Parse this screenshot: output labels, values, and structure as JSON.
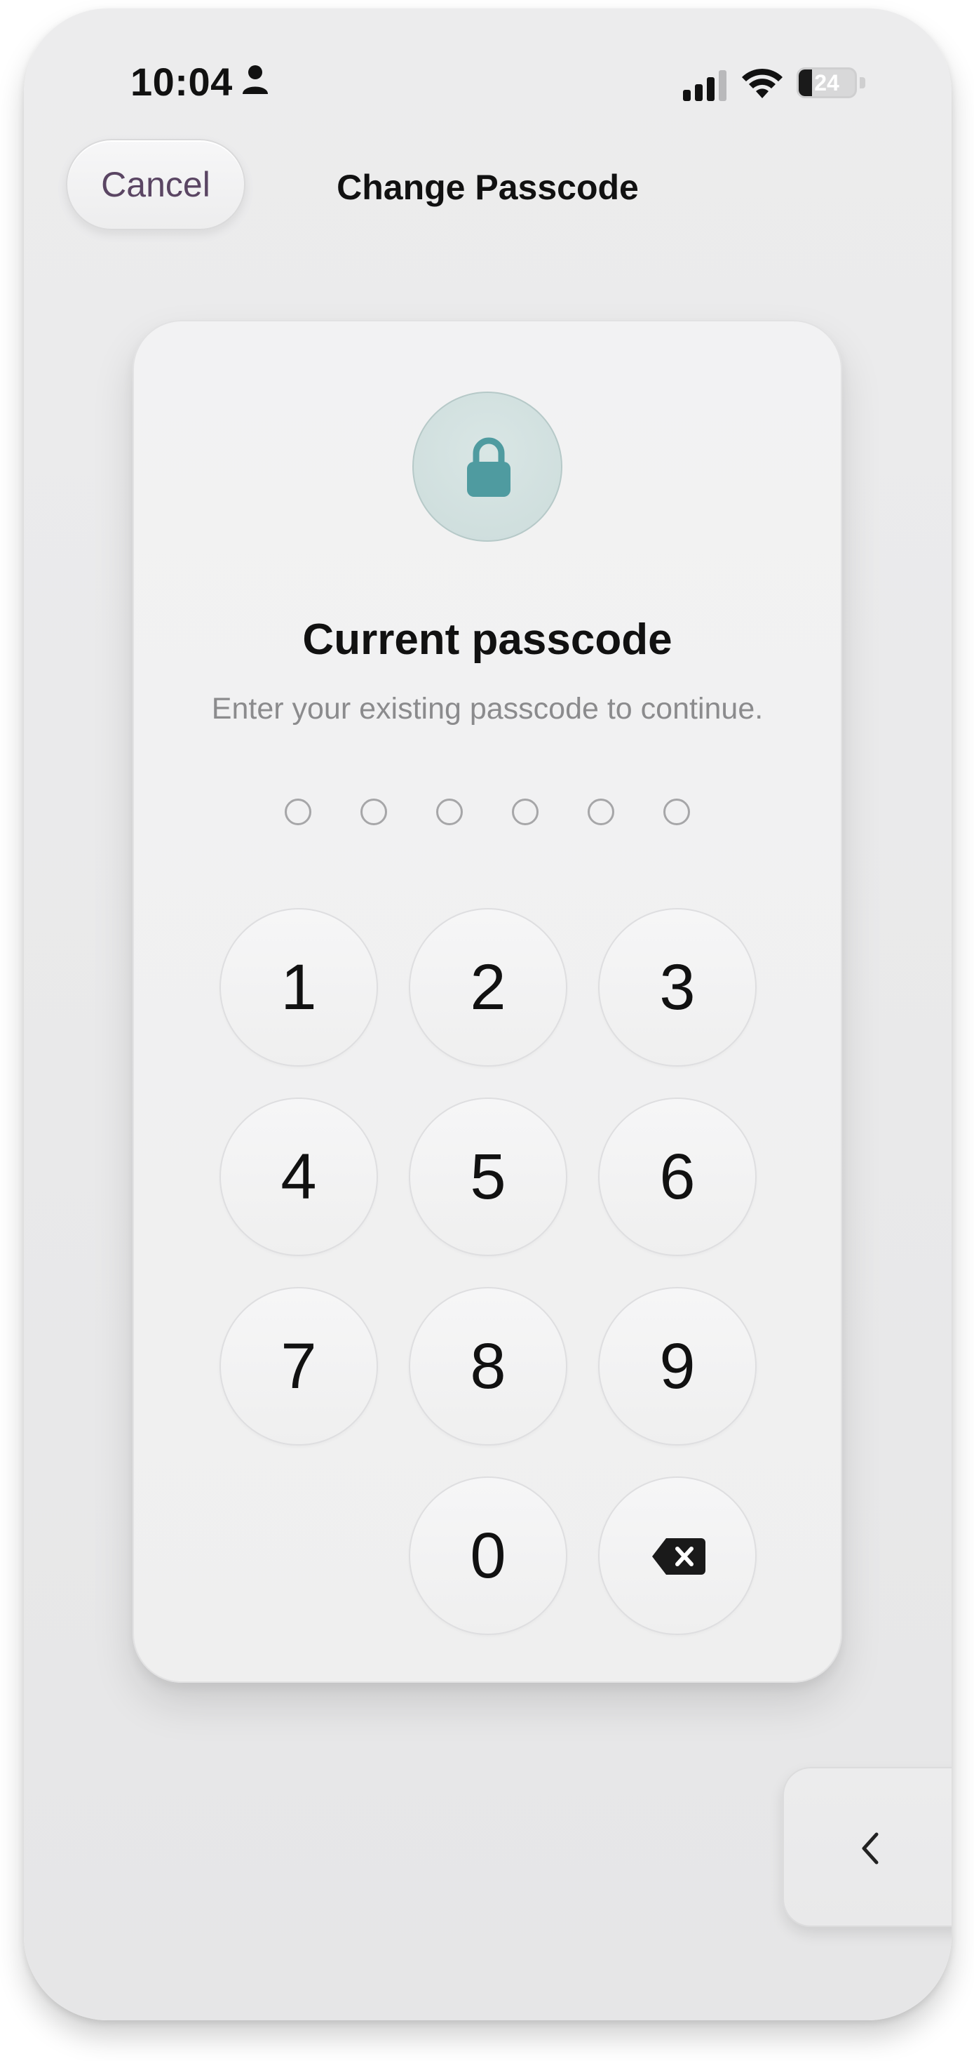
{
  "status_bar": {
    "time": "10:04",
    "battery_level": "24",
    "battery_fraction": 0.24,
    "icons": [
      "person-icon",
      "signal-icon",
      "wifi-icon",
      "battery-icon"
    ]
  },
  "header": {
    "cancel_label": "Cancel",
    "title": "Change Passcode"
  },
  "passcode_card": {
    "icon": "lock-icon",
    "title": "Current passcode",
    "subtitle": "Enter your existing passcode to continue.",
    "digit_count": 6,
    "digits_entered": 0
  },
  "keypad": {
    "keys": [
      "1",
      "2",
      "3",
      "4",
      "5",
      "6",
      "7",
      "8",
      "9",
      "0"
    ],
    "delete_icon": "backspace-icon"
  },
  "side_tab": {
    "icon": "chevron-left-icon"
  },
  "colors": {
    "accent": "#4f9ba0",
    "cancel_text": "#5a4563",
    "subtitle_text": "#8b8b8d",
    "background": "#ebebec"
  }
}
